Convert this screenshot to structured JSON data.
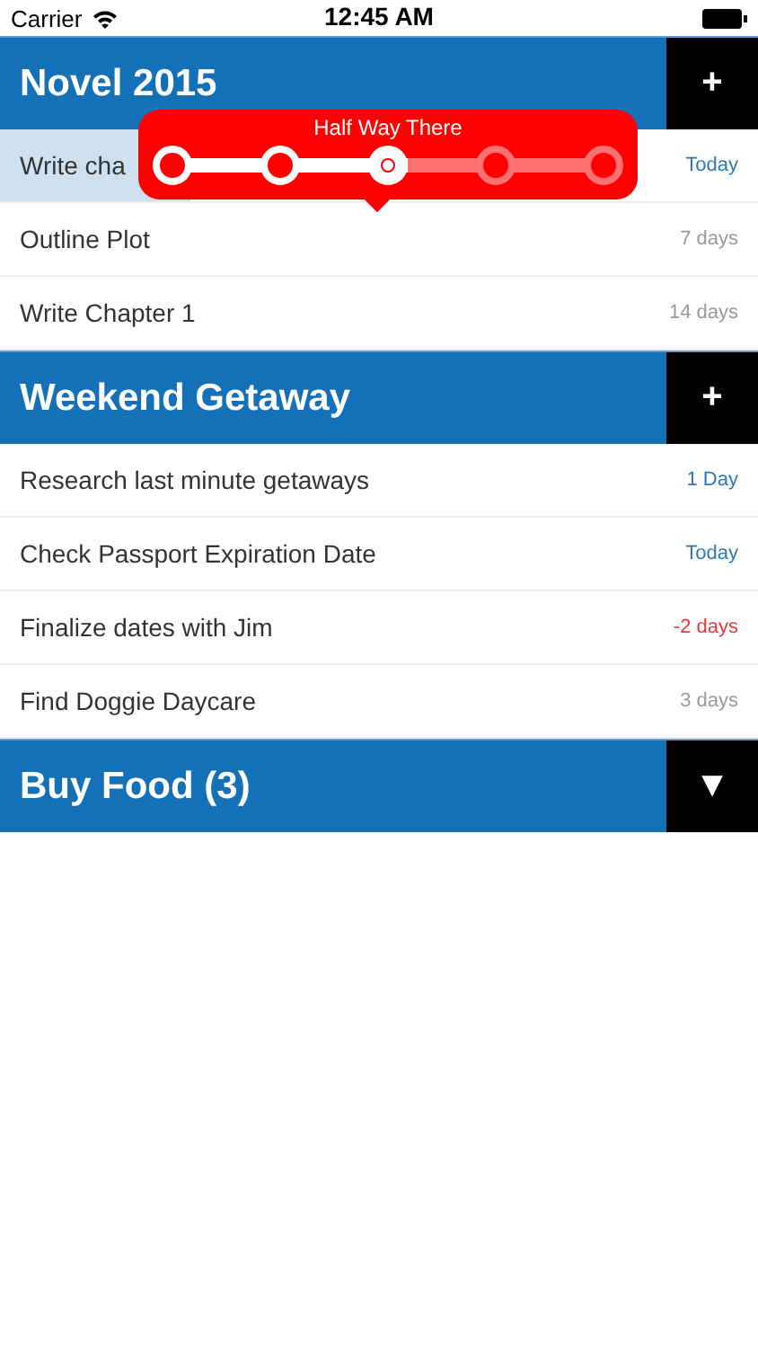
{
  "status_bar": {
    "carrier": "Carrier",
    "time": "12:45 AM"
  },
  "sections": [
    {
      "title": "Novel 2015",
      "action": "+",
      "tasks": [
        {
          "name": "Write cha",
          "due": "Today",
          "color": "#2a78bd",
          "level": 0.25
        },
        {
          "name": "Outline Plot",
          "due": "7 days",
          "color": "#999999"
        },
        {
          "name": "Write Chapter 1",
          "due": "14 days",
          "color": "#999999"
        }
      ],
      "popover": {
        "title": "Half Way There",
        "level": 0.5
      }
    },
    {
      "title": "Weekend Getaway",
      "action": "+",
      "tasks": [
        {
          "name": "Research last minute getaways",
          "due": "1 Day",
          "color": "#2a78bd"
        },
        {
          "name": "Check Passport Expiration Date",
          "due": "Today",
          "color": "#2a78bd"
        },
        {
          "name": "Finalize dates with Jim",
          "due": "-2 days",
          "color": "#e8383d"
        },
        {
          "name": "Find Doggie Daycare",
          "due": "3 days",
          "color": "#999999"
        }
      ]
    },
    {
      "title": "Buy Food (3)",
      "action": "▼"
    }
  ]
}
